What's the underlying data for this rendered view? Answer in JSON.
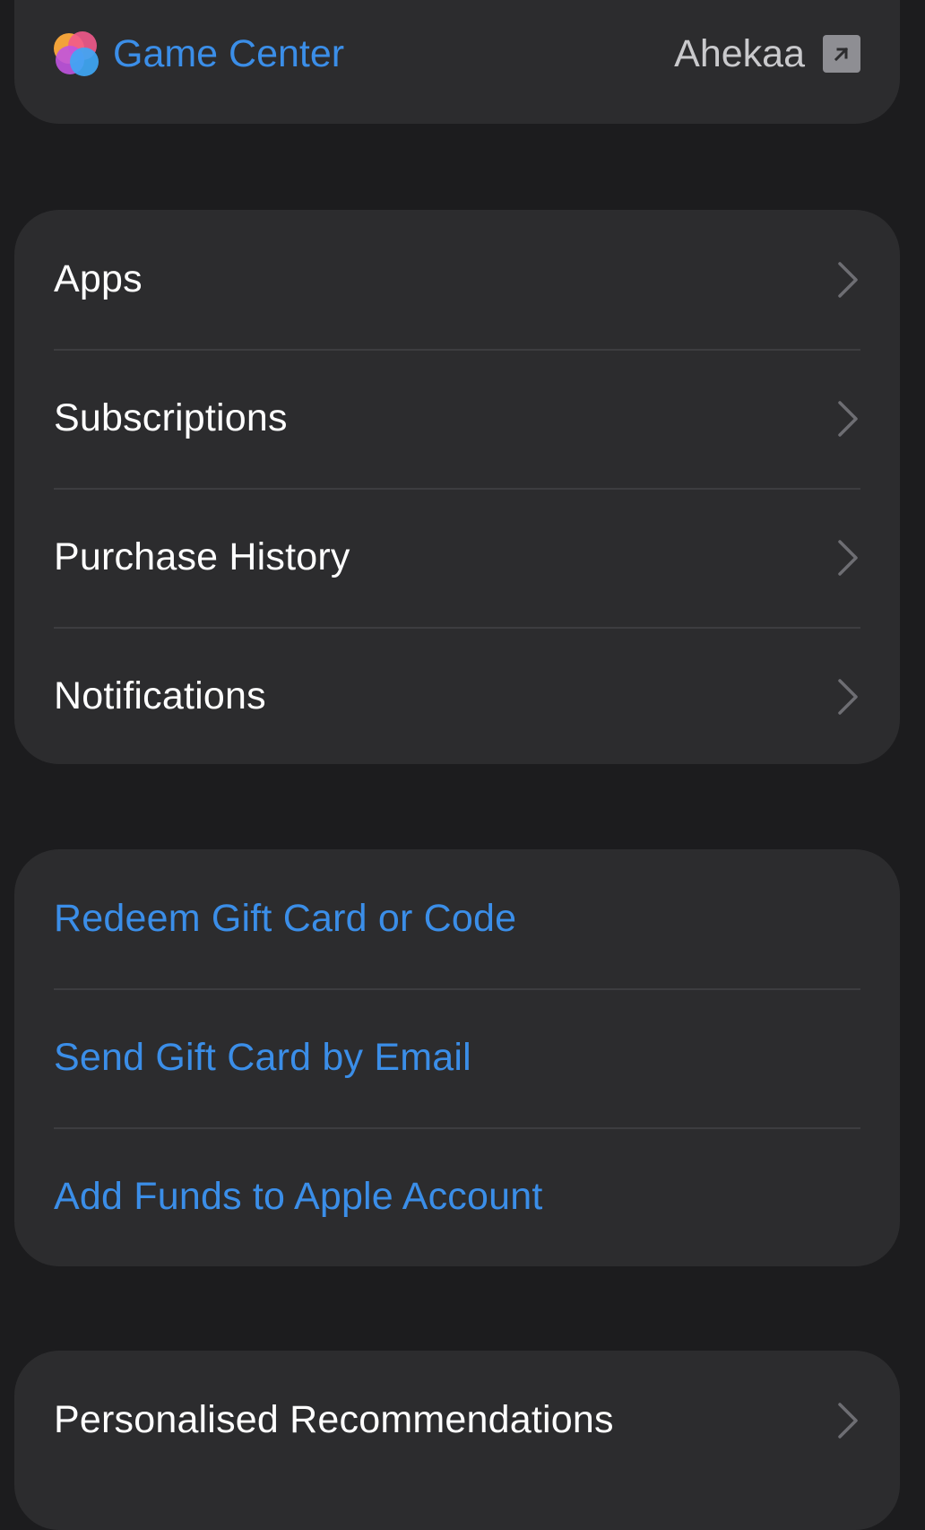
{
  "game_center": {
    "title": "Game Center",
    "username": "Ahekaa",
    "logo_icon": "game-center-bubbles-icon",
    "link_icon": "external-link-arrow-icon"
  },
  "nav_section": {
    "items": [
      {
        "label": "Apps",
        "icon": "chevron-right-icon"
      },
      {
        "label": "Subscriptions",
        "icon": "chevron-right-icon"
      },
      {
        "label": "Purchase History",
        "icon": "chevron-right-icon"
      },
      {
        "label": "Notifications",
        "icon": "chevron-right-icon"
      }
    ]
  },
  "gift_section": {
    "items": [
      {
        "label": "Redeem Gift Card or Code"
      },
      {
        "label": "Send Gift Card by Email"
      },
      {
        "label": "Add Funds to Apple Account"
      }
    ]
  },
  "recommendations_section": {
    "items": [
      {
        "label": "Personalised Recommendations",
        "icon": "chevron-right-icon"
      }
    ]
  },
  "colors": {
    "background": "#1c1c1e",
    "card": "#2c2c2e",
    "separator": "#3d3d40",
    "accent_blue": "#3b8ee8",
    "chevron": "#6e6e73"
  }
}
